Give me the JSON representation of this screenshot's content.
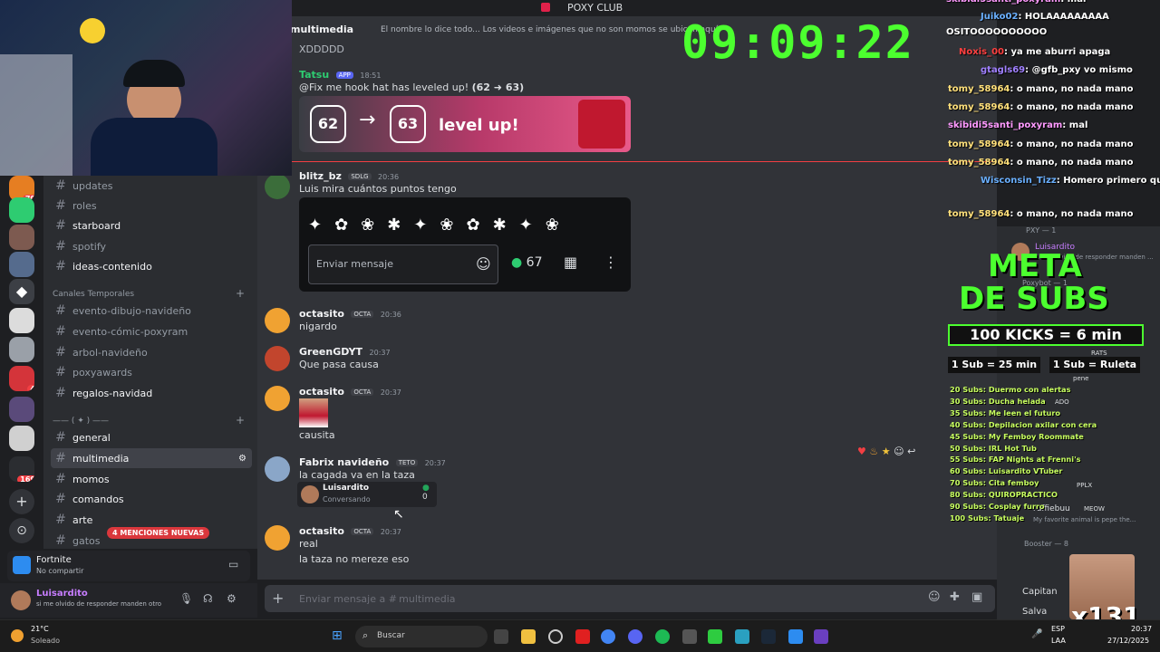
{
  "window": {
    "title": "POXY CLUB"
  },
  "channel_header": {
    "name": "multimedia",
    "topic": "El nombre lo dice todo... Los videos e imágenes que no son momos se ubican aquí"
  },
  "overlay": {
    "clock": "09:09:22",
    "meta_title_1": "META",
    "meta_title_2": "DE SUBS",
    "kicks": "100 KICKS = 6 min",
    "sub1": "1 Sub = 25 min",
    "sub2": "1 Sub = Ruleta",
    "goals": [
      "20 Subs: Duermo con alertas",
      "30 Subs: Ducha helada",
      "35 Subs: Me leen el futuro",
      "40 Subs: Depilacion axilar con cera",
      "45 Subs: My Femboy Roommate",
      "50 Subs: IRL Hot Tub",
      "55 Subs: FAP Nights at Frenni's",
      "60 Subs: Luisardito VTuber",
      "70 Subs: Cita femboy",
      "80 Subs: QUIROPRACTICO",
      "90 Subs: Cosplay furro",
      "100 Subs: Tatuaje"
    ],
    "multiplier": "x131"
  },
  "stream_chat": [
    {
      "user": "skibidi5santi_poxyram",
      "text": "mal",
      "color": "#ff9aff"
    },
    {
      "user": "Juiko02",
      "text": "HOLAAAAAAAAA",
      "color": "#6ab0ff"
    },
    {
      "user": "",
      "text": "OSITOOOOOOOOOO",
      "color": "#ffffff"
    },
    {
      "user": "Noxis_00",
      "text": "ya me aburri apaga",
      "color": "#ff4040"
    },
    {
      "user": "gtagls69",
      "text": "@gfb_pxy vo mismo",
      "color": "#a080ff"
    },
    {
      "user": "tomy_58964",
      "text": "o mano, no nada mano",
      "color": "#ffe07a"
    },
    {
      "user": "tomy_58964",
      "text": "o mano, no nada mano",
      "color": "#ffe07a"
    },
    {
      "user": "skibidi5santi_poxyram",
      "text": "mal",
      "color": "#ff9aff"
    },
    {
      "user": "tomy_58964",
      "text": "o mano, no nada mano",
      "color": "#ffe07a"
    },
    {
      "user": "tomy_58964",
      "text": "o mano, no nada mano",
      "color": "#ffe07a"
    },
    {
      "user": "Wisconsin_Tizz",
      "text": "Homero primero que sale?",
      "color": "#6ab0ff"
    },
    {
      "user": "tomy_58964",
      "text": "o mano, no nada mano",
      "color": "#ffe07a"
    }
  ],
  "sidebar": {
    "channels_top": [
      {
        "name": "updates"
      },
      {
        "name": "roles"
      },
      {
        "name": "starboard"
      },
      {
        "name": "spotify"
      },
      {
        "name": "ideas-contenido"
      }
    ],
    "category_temp": "Canales Temporales",
    "channels_temp": [
      {
        "name": "evento-dibujo-navideño"
      },
      {
        "name": "evento-cómic-poxyram"
      },
      {
        "name": "arbol-navideño"
      },
      {
        "name": "poxyawards"
      },
      {
        "name": "regalos-navidad"
      }
    ],
    "channels_main": [
      {
        "name": "general"
      },
      {
        "name": "multimedia"
      },
      {
        "name": "momos"
      },
      {
        "name": "comandos"
      },
      {
        "name": "arte"
      },
      {
        "name": "gatos"
      }
    ],
    "mention_badge": "4 MENCIONES NUEVAS",
    "server_badges": [
      "79",
      "4",
      "169"
    ]
  },
  "activity": {
    "game": "Fortnite",
    "sub": "No compartir"
  },
  "user": {
    "name": "Luisardito",
    "status": "si me olvido de responder manden otro ..."
  },
  "messages": [
    {
      "user": "",
      "text": "XDDDDD"
    },
    {
      "user": "Tatsu",
      "badge": "APP",
      "time": "18:51",
      "text_pre": "@Fix me hook hat",
      "text_mid": " has leveled up! ",
      "text_bold": "(62 ➜ 63)"
    },
    {
      "user": "blitz_bz",
      "badge": "SDLG",
      "time": "20:36",
      "text": "Luis mira cuántos puntos tengo"
    },
    {
      "user": "octasito",
      "badge": "OCTA",
      "time": "20:36",
      "text": "nigardo"
    },
    {
      "user": "GreenGDYT",
      "time": "20:37",
      "text": "Que pasa causa"
    },
    {
      "user": "octasito",
      "badge": "OCTA",
      "time": "20:37",
      "text": "causita"
    },
    {
      "user": "Fabrix navideño",
      "badge": "TETO",
      "time": "20:37",
      "text": "la cagada va en la taza"
    },
    {
      "user": "octasito",
      "badge": "OCTA",
      "time": "20:37",
      "text": "real",
      "text2": "la taza no mereze eso"
    }
  ],
  "levelup": {
    "from": "62",
    "to": "63",
    "label": "level up!"
  },
  "embed": {
    "placeholder": "Enviar mensaje",
    "points": "67"
  },
  "voice_card": {
    "name": "Luisardito",
    "status": "Conversando",
    "count": "0"
  },
  "composer": {
    "placeholder": "Enviar mensaje a # multimedia"
  },
  "members": {
    "group_pxy": "PXY — 1",
    "user1": "Luisardito",
    "user1_status": "si me olvido de responder manden ...",
    "group_bot": "Poxybot — 1",
    "group_booster": "Booster — 8",
    "boost_user": "Capitan",
    "boost_user2": "Salva",
    "ado": "ADO",
    "pplx": "PPLX",
    "meow": "MEOW",
    "rats": "RATS",
    "pene": "pene",
    "ruffiebuu": "ruffiebuu",
    "ruffie_status": "My favorite animal is pepe the..."
  },
  "taskbar": {
    "weather_temp": "21°C",
    "weather": "Soleado",
    "search": "Buscar",
    "lang1": "ESP",
    "lang2": "LAA",
    "time": "20:37",
    "date": "27/12/2025"
  },
  "colors": {
    "bg": "#313338",
    "accent": "#5865f2",
    "clock": "#4cff2f",
    "meta": "#4cff2f"
  }
}
